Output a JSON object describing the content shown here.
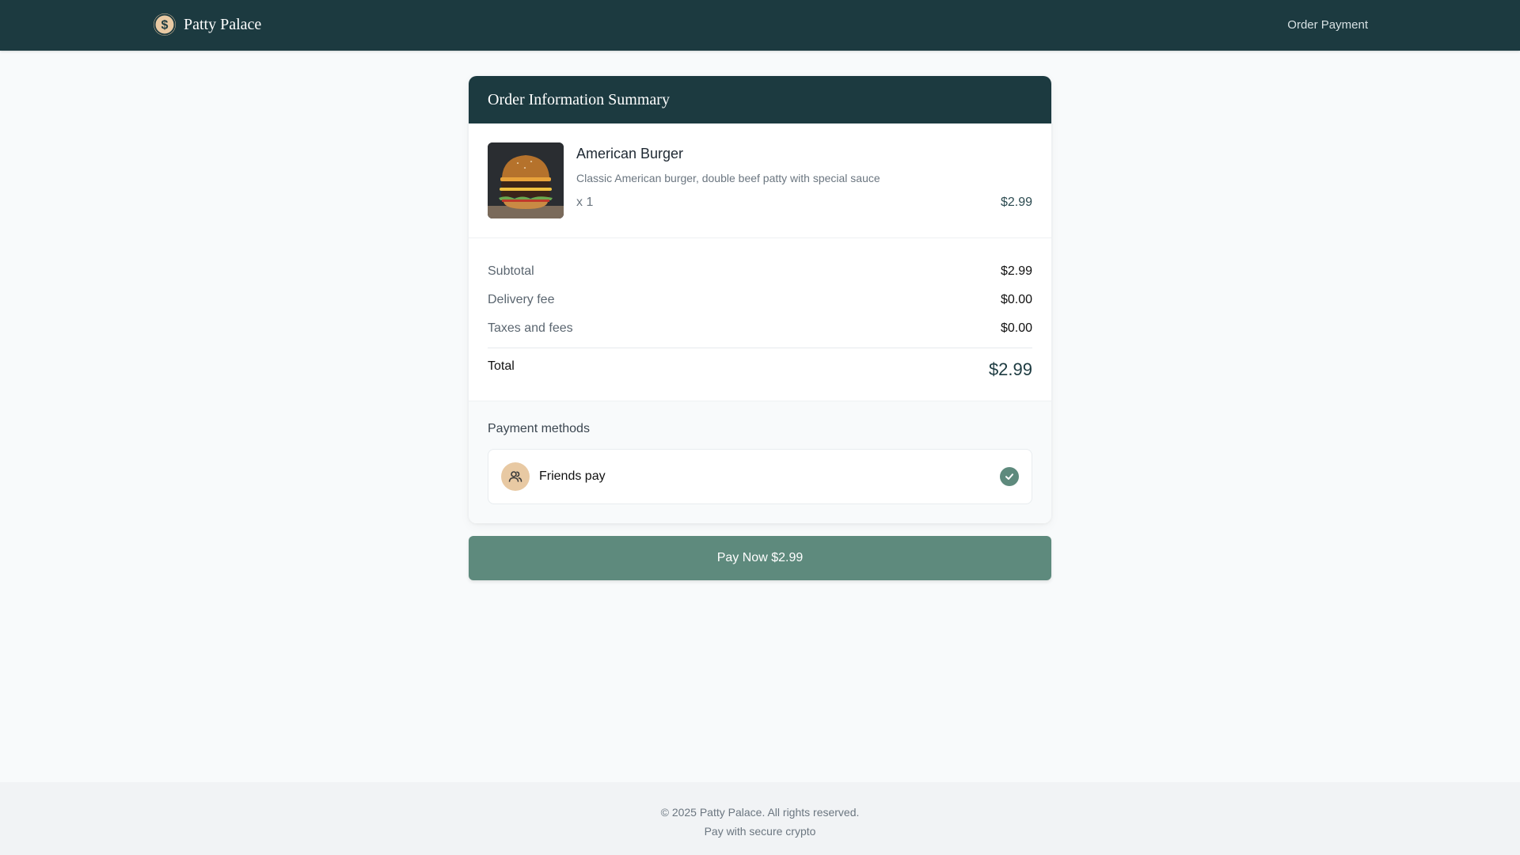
{
  "header": {
    "brand": "Patty Palace",
    "nav_link": "Order Payment"
  },
  "order": {
    "title": "Order Information Summary",
    "item": {
      "name": "American Burger",
      "description": "Classic American burger, double beef patty with special sauce",
      "quantity": "x 1",
      "price": "$2.99"
    },
    "totals": {
      "subtotal_label": "Subtotal",
      "subtotal_value": "$2.99",
      "delivery_label": "Delivery fee",
      "delivery_value": "$0.00",
      "taxes_label": "Taxes and fees",
      "taxes_value": "$0.00",
      "total_label": "Total",
      "total_value": "$2.99"
    },
    "payment": {
      "title": "Payment methods",
      "option_label": "Friends pay",
      "selected": true
    }
  },
  "actions": {
    "pay_button": "Pay Now $2.99"
  },
  "footer": {
    "copyright": "© 2025 Patty Palace. All rights reserved.",
    "tagline": "Pay with secure crypto"
  },
  "colors": {
    "header_bg": "#1c3a40",
    "accent": "#5e8a7d",
    "brand_gold": "#e8c9a3"
  }
}
